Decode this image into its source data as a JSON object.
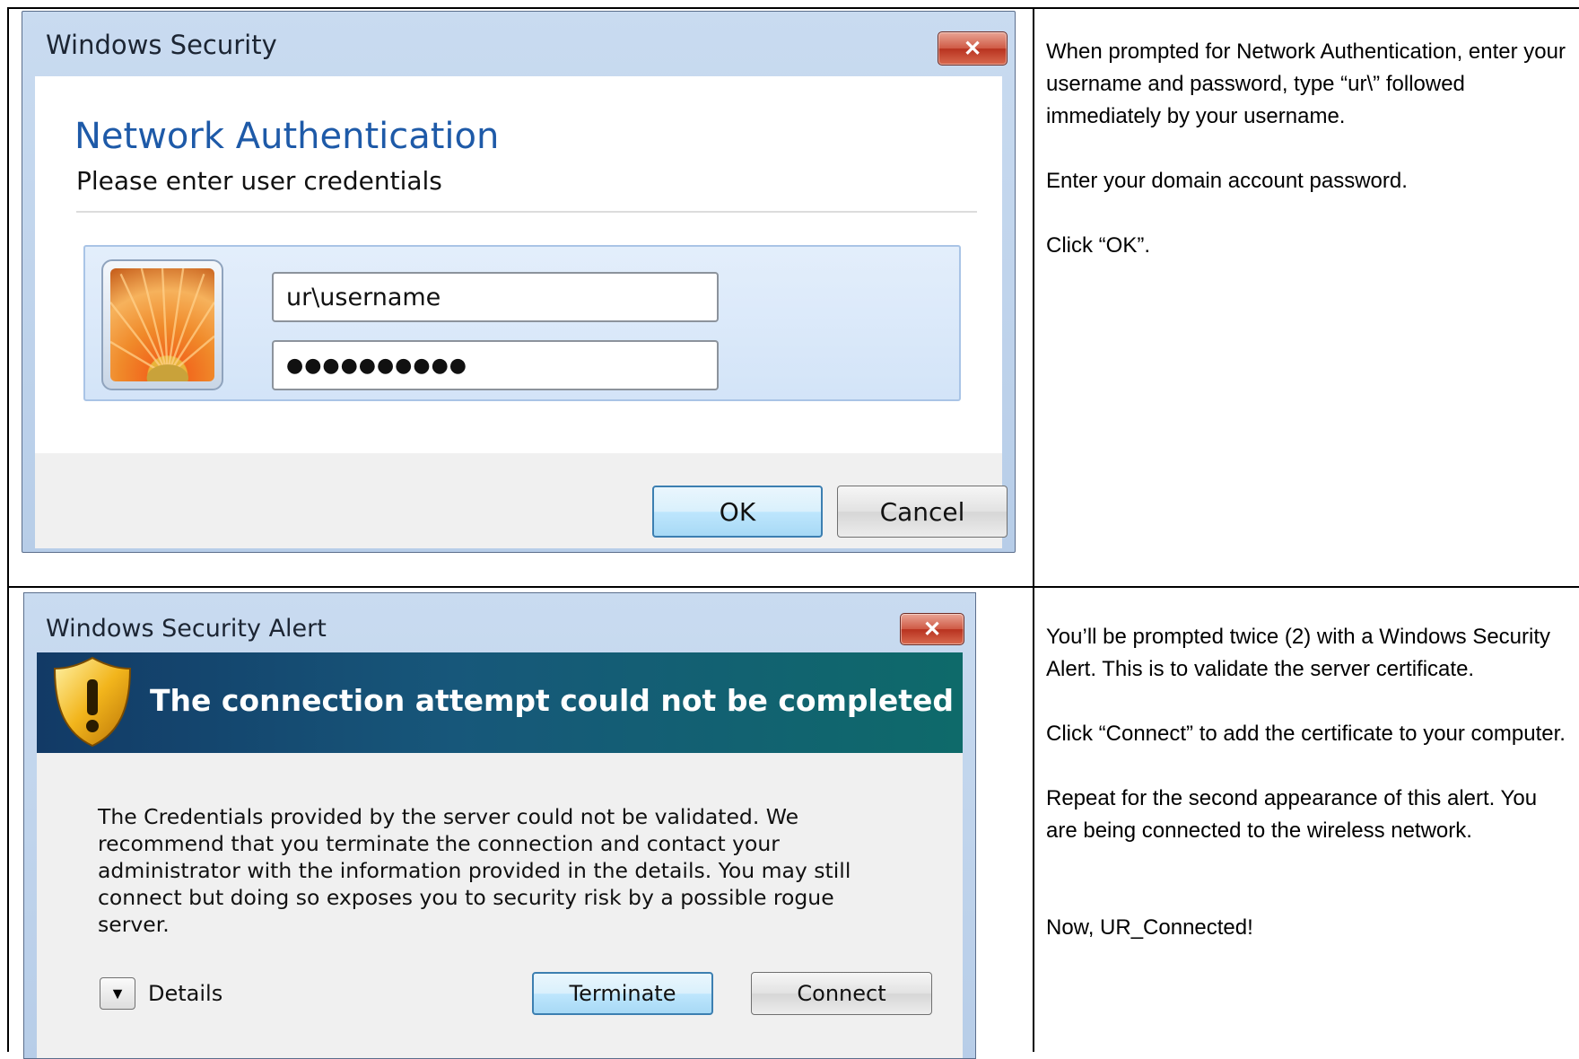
{
  "dialog1": {
    "title": "Windows Security",
    "close_label": "✕",
    "heading": "Network Authentication",
    "subheading": "Please enter user credentials",
    "username_value": "ur\\username",
    "password_value": "●●●●●●●●●●",
    "ok_label": "OK",
    "cancel_label": "Cancel",
    "icons": {
      "close": "close-icon",
      "avatar": "user-avatar-flower"
    }
  },
  "dialog2": {
    "title": "Windows Security Alert",
    "close_label": "✕",
    "banner_text": "The connection attempt could not be completed",
    "message": "The Credentials provided by the server could not be validated. We recommend that you terminate the connection and contact your administrator with the information provided in the details. You may still connect but doing so exposes you to security risk by a possible rogue server.",
    "details_arrow": "▼",
    "details_label": "Details",
    "terminate_label": "Terminate",
    "connect_label": "Connect",
    "icons": {
      "close": "close-icon",
      "warning": "warning-shield-icon",
      "expand": "chevron-down-icon"
    }
  },
  "instructions": {
    "step1": {
      "p1": "When prompted for Network Authentication, enter your username and password, type “ur\\” followed immediately by your username.",
      "p2": "Enter your domain account password.",
      "p3": "Click “OK”."
    },
    "step2": {
      "p1": "You’ll be prompted twice (2) with a Windows Security Alert. This is to validate the server certificate.",
      "p2": "Click “Connect” to add the certificate to your computer.",
      "p3": "Repeat for the second appearance of this alert. You are being connected to the wireless network.",
      "p4": "Now, UR_Connected!"
    }
  },
  "colors": {
    "heading_blue": "#1e5aa8",
    "banner_start": "#123a66",
    "banner_end": "#0e6a6a",
    "close_red": "#cf5a45"
  }
}
